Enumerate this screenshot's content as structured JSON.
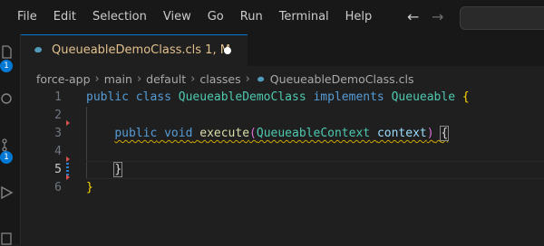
{
  "menu": [
    "File",
    "Edit",
    "Selection",
    "View",
    "Go",
    "Run",
    "Terminal",
    "Help"
  ],
  "activity": {
    "badge1": "1",
    "badge2": "1"
  },
  "tab": {
    "label": "QueueableDemoClass.cls",
    "status": "1, M"
  },
  "breadcrumb": [
    "force-app",
    "main",
    "default",
    "classes",
    "QueueableDemoClass.cls"
  ],
  "code_lines": [
    {
      "number": "1",
      "text": "public class QueueableDemoClass implements Queueable {"
    },
    {
      "number": "2",
      "text": ""
    },
    {
      "number": "3",
      "text": "    public void execute(QueueableContext context) {"
    },
    {
      "number": "4",
      "text": ""
    },
    {
      "number": "5",
      "text": "    }"
    },
    {
      "number": "6",
      "text": "}"
    }
  ],
  "tokens": {
    "public": "public",
    "class": "class",
    "class_name": "QueueableDemoClass",
    "implements": "implements",
    "interface": "Queueable",
    "open_brace": "{",
    "close_brace": "}",
    "void": "void",
    "method": "execute",
    "open_paren": "(",
    "param_type": "QueueableContext",
    "param_name": "context",
    "close_paren": ")"
  },
  "colors": {
    "keyword": "#569cd6",
    "type": "#4ec9b0",
    "function": "#dcdcaa",
    "parameter": "#9cdcfe",
    "modified_tab": "#e2c08d",
    "accent": "#0078d4"
  }
}
